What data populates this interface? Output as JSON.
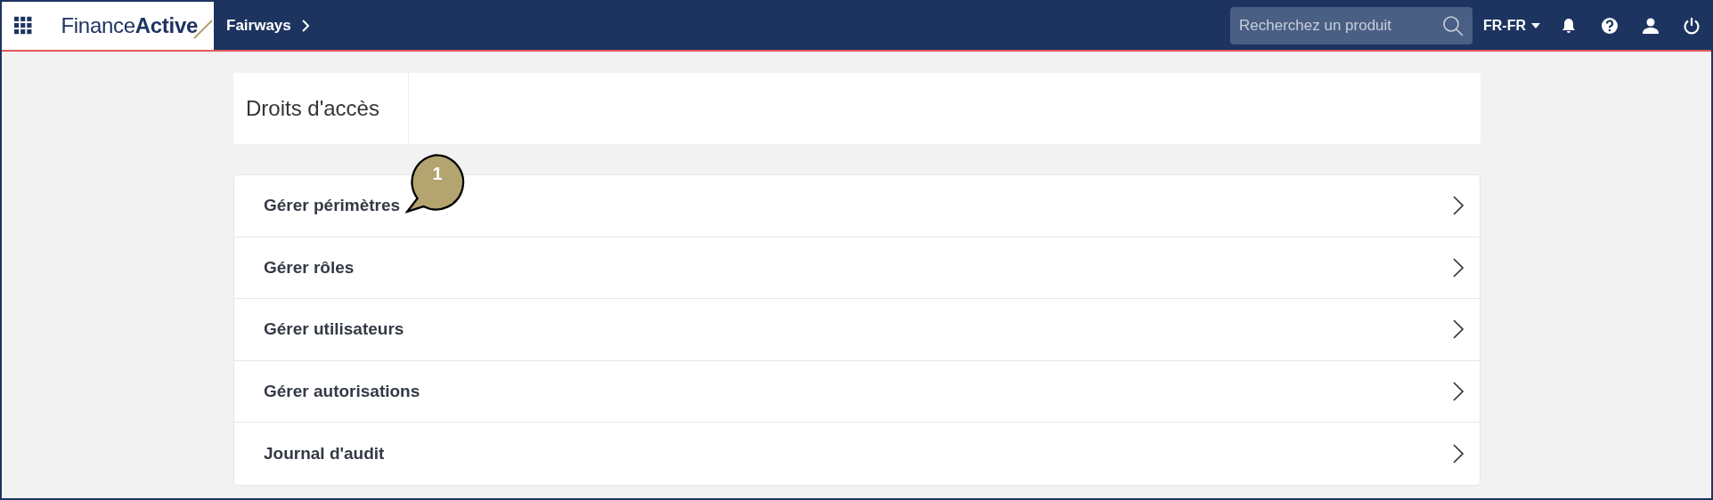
{
  "header": {
    "logo": "Finance**Active**",
    "breadcrumb": "Fairways",
    "search": {
      "placeholder": "Recherchez un produit"
    },
    "language": "FR-FR"
  },
  "page_title": "Droits d'accès",
  "menu": [
    {
      "label": "Gérer périmètres"
    },
    {
      "label": "Gérer rôles"
    },
    {
      "label": "Gérer utilisateurs"
    },
    {
      "label": "Gérer autorisations"
    },
    {
      "label": "Journal d'audit"
    }
  ],
  "callout": {
    "number": "1"
  }
}
